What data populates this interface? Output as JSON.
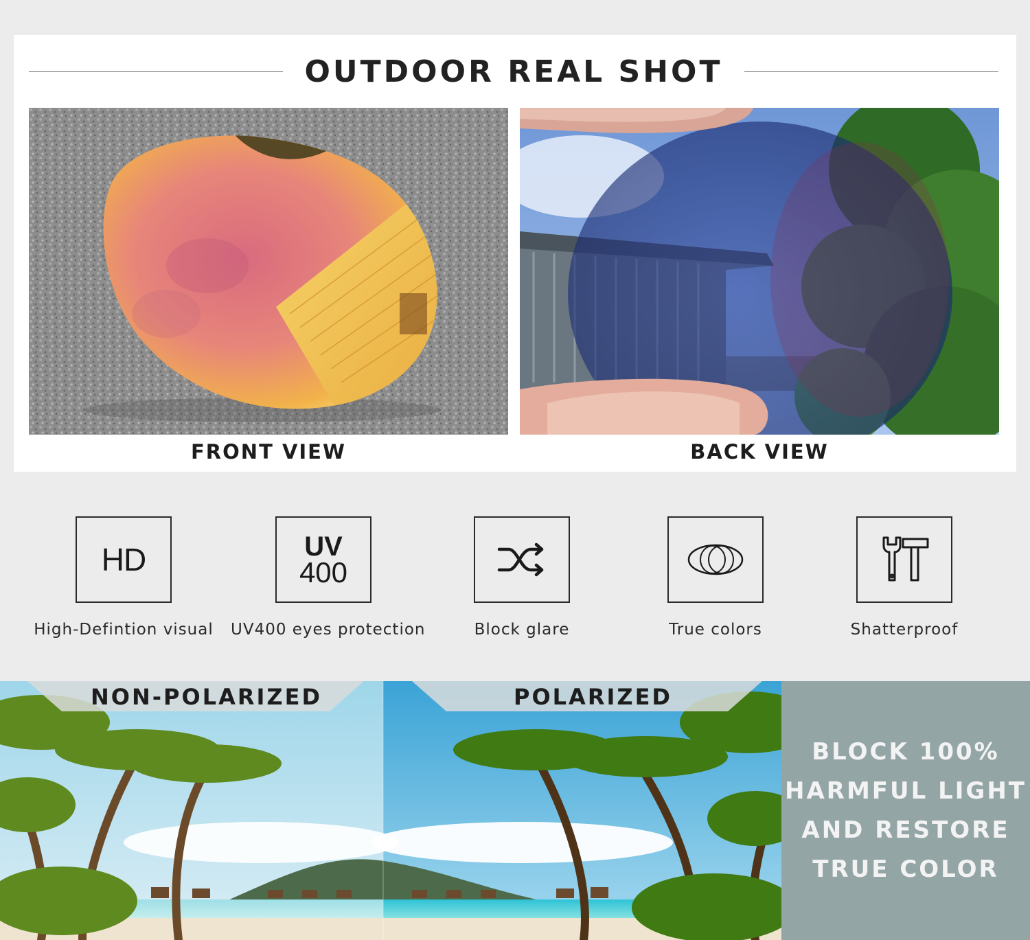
{
  "header": {
    "title": "OUTDOOR REAL SHOT"
  },
  "views": {
    "front_caption": "FRONT VIEW",
    "back_caption": "BACK VIEW"
  },
  "features": [
    {
      "icon": "hd-icon",
      "icon_text": "HD",
      "label": "High-Defintion visual"
    },
    {
      "icon": "uv400-icon",
      "icon_text_top": "UV",
      "icon_text_bottom": "400",
      "label": "UV400 eyes protection"
    },
    {
      "icon": "shuffle-arrows-icon",
      "label": "Block glare"
    },
    {
      "icon": "overlapping-circles-icon",
      "label": "True colors"
    },
    {
      "icon": "wrench-hammer-icon",
      "label": "Shatterproof"
    }
  ],
  "comparison": {
    "left_label": "NON-POLARIZED",
    "right_label": "POLARIZED",
    "claim_lines": [
      "BLOCK 100%",
      "HARMFUL LIGHT",
      "AND RESTORE",
      "TRUE COLOR"
    ]
  },
  "colors": {
    "background": "#ececec",
    "card": "#ffffff",
    "claim_panel": "#94a5a6",
    "lens_mirror": "#f2b24a",
    "lens_pink": "#e27a7e"
  }
}
